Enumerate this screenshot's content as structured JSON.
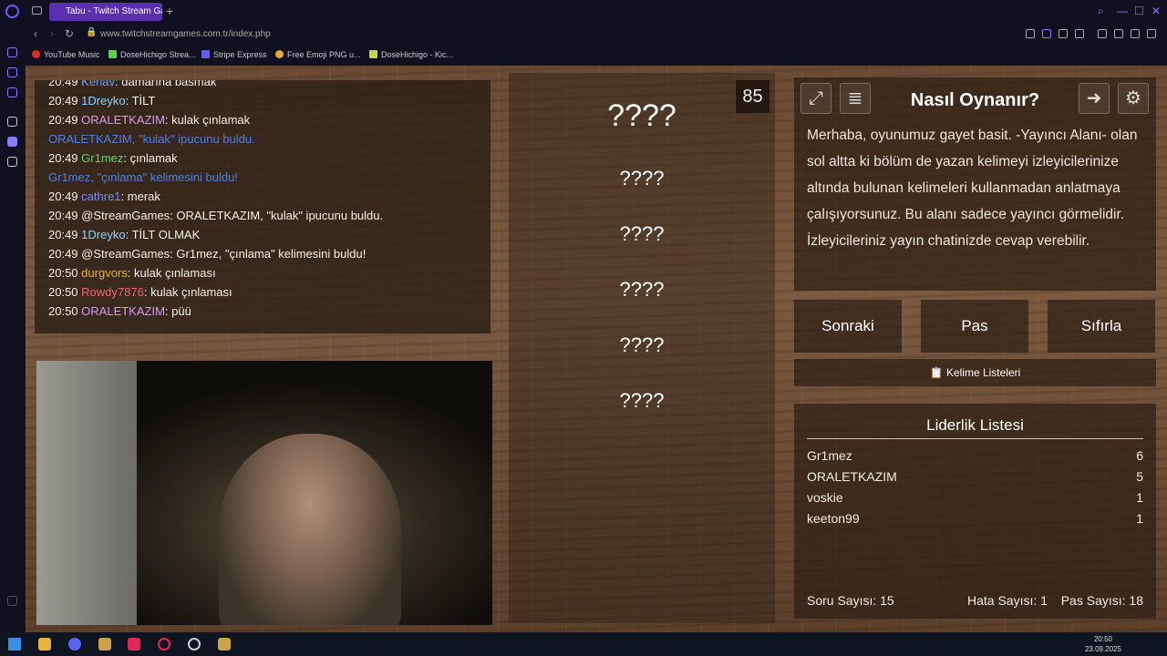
{
  "browser": {
    "tab_title": "Tabu - Twitch Stream Games",
    "url": "www.twitchstreamgames.com.tr/index.php"
  },
  "bookmarks": [
    "YouTube Music",
    "DoseHichigo Strea...",
    "Stripe Express",
    "Free Emoji PNG u...",
    "DoseHichigo - Kic..."
  ],
  "chat": [
    {
      "time": "20:49",
      "user": "Kenav",
      "text": "damarına basmak"
    },
    {
      "time": "20:49",
      "user": "1Dreyko",
      "text": "TİLT"
    },
    {
      "time": "20:49",
      "user": "ORALETKAZIM",
      "text": "kulak çınlamak"
    },
    {
      "system": "ORALETKAZIM, \"kulak\" ipucunu buldu."
    },
    {
      "time": "20:49",
      "user": "Gr1mez",
      "text": "çınlamak"
    },
    {
      "system": "Gr1mez, \"çınlama\" kelimesini buldu!"
    },
    {
      "time": "20:49",
      "user": "cathre1",
      "text": "merak"
    },
    {
      "time": "20:49",
      "user": "@StreamGames",
      "text": "ORALETKAZIM, \"kulak\" ipucunu buldu."
    },
    {
      "time": "20:49",
      "user": "1Dreyko",
      "text": "TİLT OLMAK"
    },
    {
      "time": "20:49",
      "user": "@StreamGames",
      "text": "Gr1mez, \"çınlama\" kelimesini buldu!"
    },
    {
      "time": "20:50",
      "user": "durgvors",
      "text": "kulak çınlaması"
    },
    {
      "time": "20:50",
      "user": "Rowdy7876",
      "text": "kulak çınlaması"
    },
    {
      "time": "20:50",
      "user": "ORALETKAZIM",
      "text": "püü"
    }
  ],
  "game": {
    "timer": "85",
    "main_word": "????",
    "forbidden_words": [
      "????",
      "????",
      "????",
      "????",
      "????"
    ],
    "how_to_title": "Nasıl Oynanır?",
    "how_to_text": "Merhaba, oyunumuz gayet basit. -Yayıncı Alanı- olan sol altta ki bölüm de yazan kelimeyi izleyicilerinize altında bulunan kelimeleri kullanmadan anlatmaya çalışıyorsunuz. Bu alanı sadece yayıncı görmelidir. İzleyicileriniz yayın chatinizde cevap verebilir.",
    "buttons": {
      "next": "Sonraki",
      "pass": "Pas",
      "reset": "Sıfırla"
    },
    "word_lists": "Kelime Listeleri",
    "leaderboard": {
      "title": "Liderlik Listesi",
      "rows": [
        {
          "name": "Gr1mez",
          "score": "6"
        },
        {
          "name": "ORALETKAZIM",
          "score": "5"
        },
        {
          "name": "voskie",
          "score": "1"
        },
        {
          "name": "keeton99",
          "score": "1"
        }
      ]
    },
    "stats": {
      "questions": "Soru Sayısı: 15",
      "errors": "Hata Sayısı: 1",
      "passes": "Pas Sayısı: 18"
    }
  },
  "taskbar": {
    "time": "20:50",
    "date": "23.09.2025"
  },
  "colors": {
    "opera": "#6b5cff",
    "system_msg": "#4f7fe0",
    "kulak_hint": "#e03434",
    "cinlama_hint": "#4ea14b"
  }
}
